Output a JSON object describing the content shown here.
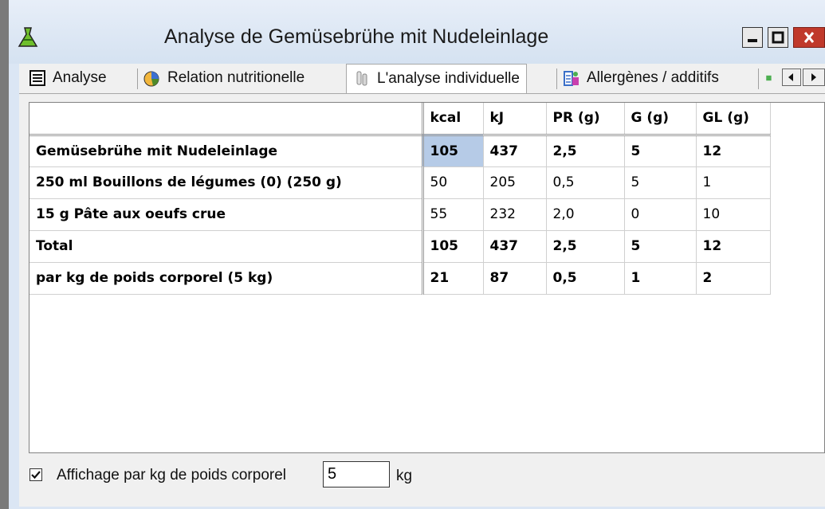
{
  "window": {
    "title": "Analyse de Gemüsebrühe mit Nudeleinlage",
    "colors": {
      "title_bar": "#dbe6f4",
      "close": "#c0392b",
      "selected_cell": "#b6cbe7"
    }
  },
  "tabs": [
    {
      "label": "Analyse",
      "icon": "grid-icon"
    },
    {
      "label": "Relation nutritionelle",
      "icon": "pie-chart-icon"
    },
    {
      "label": "L'analyse individuelle",
      "icon": "vial-icon",
      "selected": true
    },
    {
      "label": "Allergènes / additifs",
      "icon": "allergen-icon"
    },
    {
      "label": "",
      "icon": "green-icon"
    }
  ],
  "table": {
    "columns": [
      "",
      "kcal",
      "kJ",
      "PR (g)",
      "G (g)",
      "GL (g)"
    ],
    "rows": [
      {
        "label": "Gemüsebrühe mit Nudeleinlage",
        "values": [
          "105",
          "437",
          "2,5",
          "5",
          "12"
        ],
        "bold": true
      },
      {
        "label": "250 ml Bouillons de légumes (0) (250 g)",
        "values": [
          "50",
          "205",
          "0,5",
          "5",
          "1"
        ],
        "bold": false
      },
      {
        "label": "15 g Pâte aux oeufs crue",
        "values": [
          "55",
          "232",
          "2,0",
          "0",
          "10"
        ],
        "bold": false
      },
      {
        "label": "Total",
        "values": [
          "105",
          "437",
          "2,5",
          "5",
          "12"
        ],
        "bold": true
      },
      {
        "label": "par kg de poids corporel (5 kg)",
        "values": [
          "21",
          "87",
          "0,5",
          "1",
          "2"
        ],
        "bold": true
      }
    ]
  },
  "footer": {
    "checkbox_label": "Affichage par kg de poids corporel",
    "checked": true,
    "weight_value": "5",
    "unit": "kg"
  }
}
